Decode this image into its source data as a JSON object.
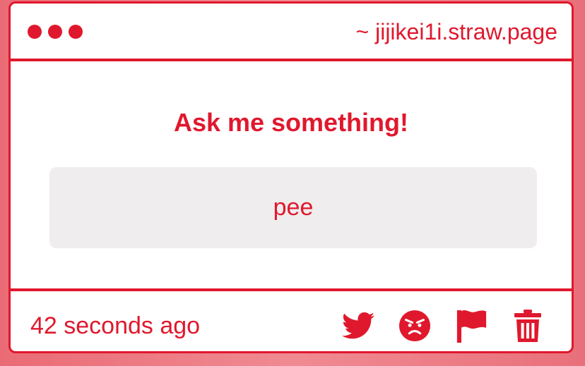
{
  "window": {
    "url": "~ jijikei1i.straw.page"
  },
  "question": {
    "prompt": "Ask me something!",
    "answer": "pee"
  },
  "footer": {
    "timestamp": "42 seconds ago",
    "actions": [
      {
        "icon": "twitter-icon"
      },
      {
        "icon": "angry-face-icon"
      },
      {
        "icon": "flag-icon"
      },
      {
        "icon": "trash-icon"
      }
    ]
  },
  "colors": {
    "accent": "#e0182d",
    "answer_background": "#efedee",
    "card_background": "#ffffff",
    "page_background": "#e8737c"
  }
}
